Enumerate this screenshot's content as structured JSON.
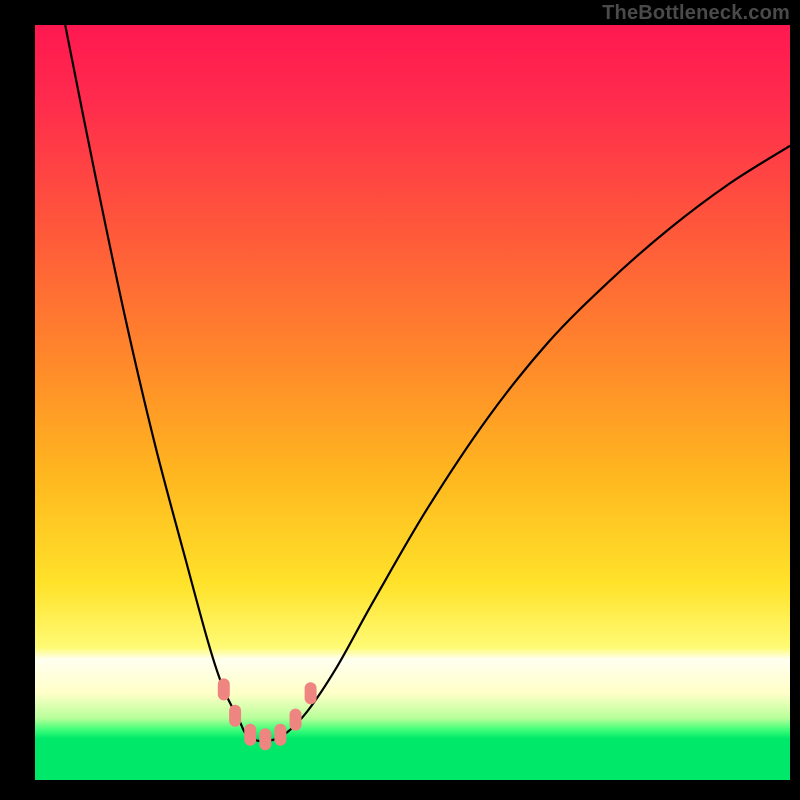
{
  "watermark": "TheBottleneck.com",
  "colors": {
    "background": "#000000",
    "gradient_top": "#ff1850",
    "gradient_mid": "#ffb81f",
    "gradient_low": "#fffb76",
    "gradient_bottom": "#00e86a",
    "curve": "#000000",
    "marker_fill": "#ef8581",
    "watermark": "#4a4a4a"
  },
  "chart_data": {
    "type": "line",
    "title": "",
    "xlabel": "",
    "ylabel": "",
    "xlim": [
      0,
      100
    ],
    "ylim": [
      0,
      100
    ],
    "grid": false,
    "legend": false,
    "series": [
      {
        "name": "bottleneck-curve",
        "x": [
          4,
          8,
          12,
          16,
          20,
          23,
          25,
          27,
          28,
          29.5,
          31,
          33,
          36,
          40,
          45,
          52,
          60,
          68,
          76,
          84,
          92,
          100
        ],
        "values": [
          100,
          80,
          61,
          44,
          29,
          18,
          12,
          8,
          6,
          5.2,
          5.2,
          6,
          9,
          15,
          24,
          36,
          48,
          58,
          66,
          73,
          79,
          84
        ]
      }
    ],
    "markers": [
      {
        "x": 25.0,
        "y": 12.0
      },
      {
        "x": 26.5,
        "y": 8.5
      },
      {
        "x": 28.5,
        "y": 6.0
      },
      {
        "x": 30.5,
        "y": 5.4
      },
      {
        "x": 32.5,
        "y": 6.0
      },
      {
        "x": 34.5,
        "y": 8.0
      },
      {
        "x": 36.5,
        "y": 11.5
      }
    ]
  }
}
